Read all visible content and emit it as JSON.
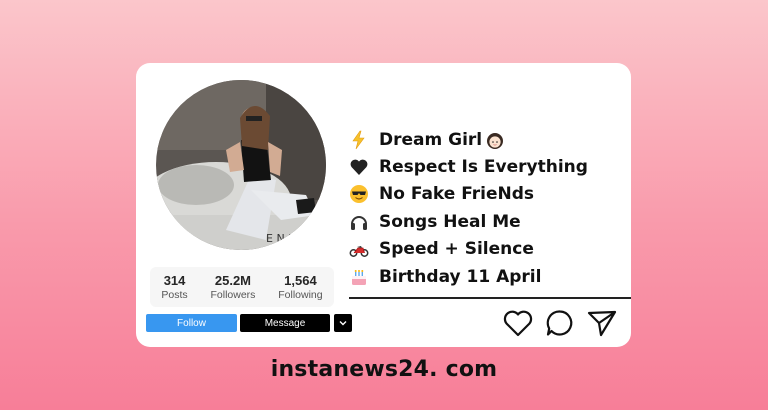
{
  "profile": {
    "stats": [
      {
        "value": "314",
        "label": "Posts"
      },
      {
        "value": "25.2M",
        "label": "Followers"
      },
      {
        "value": "1,564",
        "label": "Following"
      }
    ],
    "buttons": {
      "follow": "Follow",
      "message": "Message"
    },
    "bio": [
      {
        "icon": "lightning-icon",
        "text": "Dream Girl",
        "suffix_icon": "girl-face-icon"
      },
      {
        "icon": "black-heart-icon",
        "text": "Respect Is Everything"
      },
      {
        "icon": "sunglasses-face-icon",
        "text": "No Fake FrieNds"
      },
      {
        "icon": "headphones-icon",
        "text": "Songs Heal Me"
      },
      {
        "icon": "motorcycle-icon",
        "text": "Speed + Silence"
      },
      {
        "icon": "birthday-cake-icon",
        "text": "Birthday 11 April"
      }
    ]
  },
  "footer": {
    "site": "instanews24. com"
  },
  "colors": {
    "follow_button": "#3897f0",
    "message_button": "#000000",
    "background_top": "#fbc6cb",
    "background_bottom": "#f77e98"
  }
}
